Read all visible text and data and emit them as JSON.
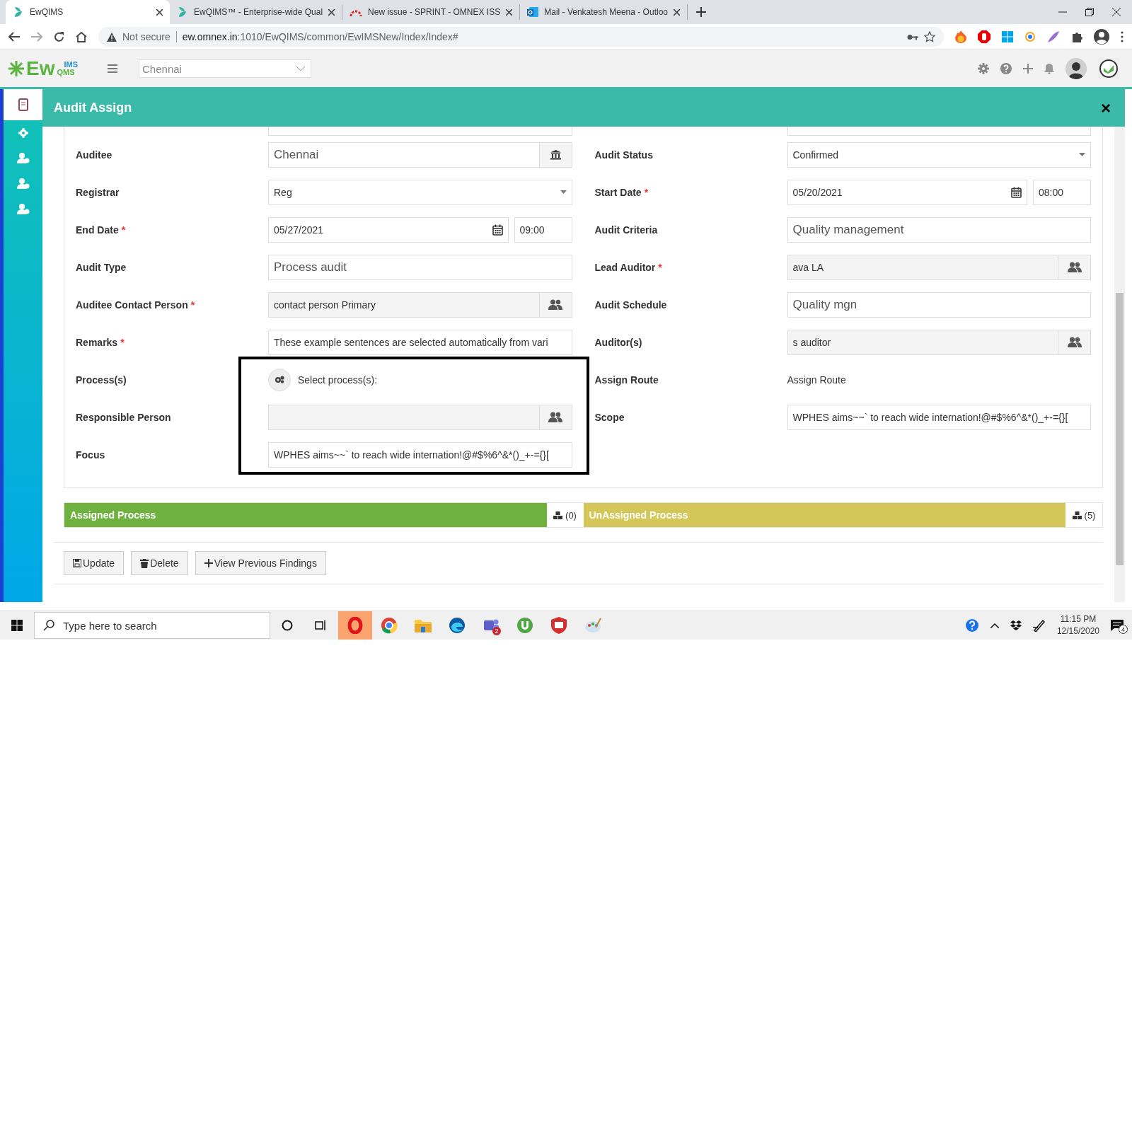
{
  "browser": {
    "tabs": [
      {
        "title": "EwQIMS",
        "selected": true
      },
      {
        "title": "EwQIMS™ - Enterprise-wide Qual",
        "selected": false
      },
      {
        "title": "New issue - SPRINT - OMNEX ISS",
        "selected": false
      },
      {
        "title": "Mail - Venkatesh Meena - Outloo",
        "selected": false
      }
    ],
    "security": "Not secure",
    "url_host": "ew.omnex.in",
    "url_path": ":1010/EwQIMS/common/EwIMSNew/Index/Index#"
  },
  "app": {
    "logo": {
      "main": "Ew",
      "top": "IMS",
      "bottom": "QMS"
    },
    "location": "Chennai"
  },
  "sidebar": {
    "items": [
      {
        "selected": true
      },
      {
        "selected": false
      },
      {
        "selected": false
      },
      {
        "selected": false
      },
      {
        "selected": false
      }
    ]
  },
  "dialog": {
    "title": "Audit Assign",
    "close": "×",
    "left": [
      {
        "label": "Auditee",
        "kind": "site-lookup",
        "value": "Chennai"
      },
      {
        "label": "Registrar",
        "kind": "select",
        "value": "Reg"
      },
      {
        "label": "End Date",
        "required_mark": "*",
        "kind": "date",
        "value": "05/27/2021",
        "time": "09:00"
      },
      {
        "label": "Audit Type",
        "kind": "display",
        "value": "Process audit"
      },
      {
        "label": "Auditee Contact Person",
        "required_mark": "*",
        "kind": "lookup",
        "value": "contact person Primary"
      },
      {
        "label": "Remarks",
        "required_mark": "*",
        "kind": "input",
        "value": "These example sentences are selected automatically from vari"
      },
      {
        "label": "Process(s)",
        "kind": "process",
        "value": "Select process(s):",
        "highlighted": true
      },
      {
        "label": "Responsible Person",
        "kind": "lookup",
        "highlighted": true
      },
      {
        "label": "Focus",
        "kind": "input",
        "value": "WPHES aims~~`  to reach  wide internation!@#$%6^&*()_+-={}[",
        "highlighted": true
      }
    ],
    "right": [
      {
        "label": "Audit Status",
        "kind": "select",
        "value": "Confirmed"
      },
      {
        "label": "Start Date",
        "required_mark": "*",
        "kind": "date",
        "value": "05/20/2021",
        "time": "08:00"
      },
      {
        "label": "Audit Criteria",
        "kind": "display",
        "value": "Quality management"
      },
      {
        "label": "Lead Auditor",
        "required_mark": "*",
        "kind": "lookup",
        "value": "ava LA"
      },
      {
        "label": "Audit Schedule",
        "kind": "display",
        "value": "Quality mgn"
      },
      {
        "label": "Auditor(s)",
        "kind": "lookup",
        "value": "s auditor"
      },
      {
        "label": "Assign Route",
        "kind": "static",
        "value": "Assign Route"
      },
      {
        "label": "Scope",
        "kind": "input",
        "value": "WPHES aims~~`  to reach  wide internation!@#$%6^&*()_+-={}["
      }
    ],
    "process_bars": [
      {
        "title": "Assigned Process",
        "count": "(0)",
        "color": "#6eb13f"
      },
      {
        "title": "UnAssigned Process",
        "count": "(5)",
        "color": "#d4c75a"
      }
    ],
    "buttons": [
      {
        "label": "Update",
        "kind": "save"
      },
      {
        "label": "Delete",
        "kind": "delete"
      },
      {
        "label": "View Previous Findings",
        "kind": "add"
      }
    ]
  },
  "taskbar": {
    "search_placeholder": "Type here to search",
    "app_badge": "2",
    "time": "11:15 PM",
    "date": "12/15/2020",
    "notifications": "4"
  }
}
